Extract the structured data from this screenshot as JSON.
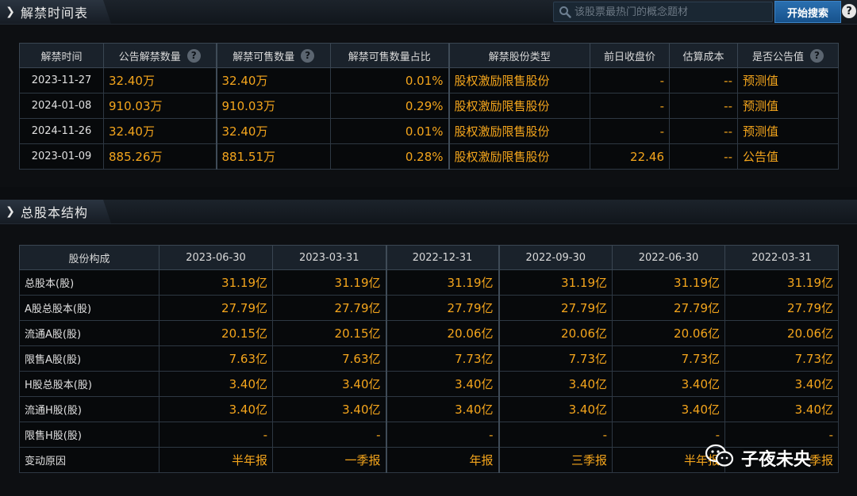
{
  "section1": {
    "title": "解禁时间表",
    "search": {
      "placeholder": "该股票最热门的概念题材",
      "button_label": "开始搜索"
    },
    "help_label": "?",
    "columns": [
      "解禁时间",
      "公告解禁数量",
      "解禁可售数量",
      "解禁可售数量占比",
      "解禁股份类型",
      "前日收盘价",
      "估算成本",
      "是否公告值"
    ],
    "rows": [
      [
        "2023-11-27",
        "32.40万",
        "32.40万",
        "0.01%",
        "股权激励限售股份",
        "-",
        "--",
        "预测值"
      ],
      [
        "2024-01-08",
        "910.03万",
        "910.03万",
        "0.29%",
        "股权激励限售股份",
        "-",
        "--",
        "预测值"
      ],
      [
        "2024-11-26",
        "32.40万",
        "32.40万",
        "0.01%",
        "股权激励限售股份",
        "-",
        "--",
        "预测值"
      ],
      [
        "2023-01-09",
        "885.26万",
        "881.51万",
        "0.28%",
        "股权激励限售股份",
        "22.46",
        "--",
        "公告值"
      ]
    ]
  },
  "section2": {
    "title": "总股本结构",
    "columns": [
      "股份构成",
      "2023-06-30",
      "2023-03-31",
      "2022-12-31",
      "2022-09-30",
      "2022-06-30",
      "2022-03-31"
    ],
    "rows": [
      [
        "总股本(股)",
        "31.19亿",
        "31.19亿",
        "31.19亿",
        "31.19亿",
        "31.19亿",
        "31.19亿"
      ],
      [
        "A股总股本(股)",
        "27.79亿",
        "27.79亿",
        "27.79亿",
        "27.79亿",
        "27.79亿",
        "27.79亿"
      ],
      [
        "流通A股(股)",
        "20.15亿",
        "20.15亿",
        "20.06亿",
        "20.06亿",
        "20.06亿",
        "20.06亿"
      ],
      [
        "限售A股(股)",
        "7.63亿",
        "7.63亿",
        "7.73亿",
        "7.73亿",
        "7.73亿",
        "7.73亿"
      ],
      [
        "H股总股本(股)",
        "3.40亿",
        "3.40亿",
        "3.40亿",
        "3.40亿",
        "3.40亿",
        "3.40亿"
      ],
      [
        "流通H股(股)",
        "3.40亿",
        "3.40亿",
        "3.40亿",
        "3.40亿",
        "3.40亿",
        "3.40亿"
      ],
      [
        "限售H股(股)",
        "-",
        "-",
        "-",
        "-",
        "-",
        "-"
      ],
      [
        "变动原因",
        "半年报",
        "一季报",
        "年报",
        "三季报",
        "半年报",
        "一季报"
      ]
    ],
    "indented_rows": [
      2,
      3,
      5,
      6,
      7
    ]
  },
  "watermark": {
    "text": "子夜未央",
    "icon": "wechat-icon"
  },
  "colors": {
    "value": "#f4a51c",
    "header_bg": "#1a222b",
    "button": "#17528c",
    "background": "#0b0d10"
  }
}
